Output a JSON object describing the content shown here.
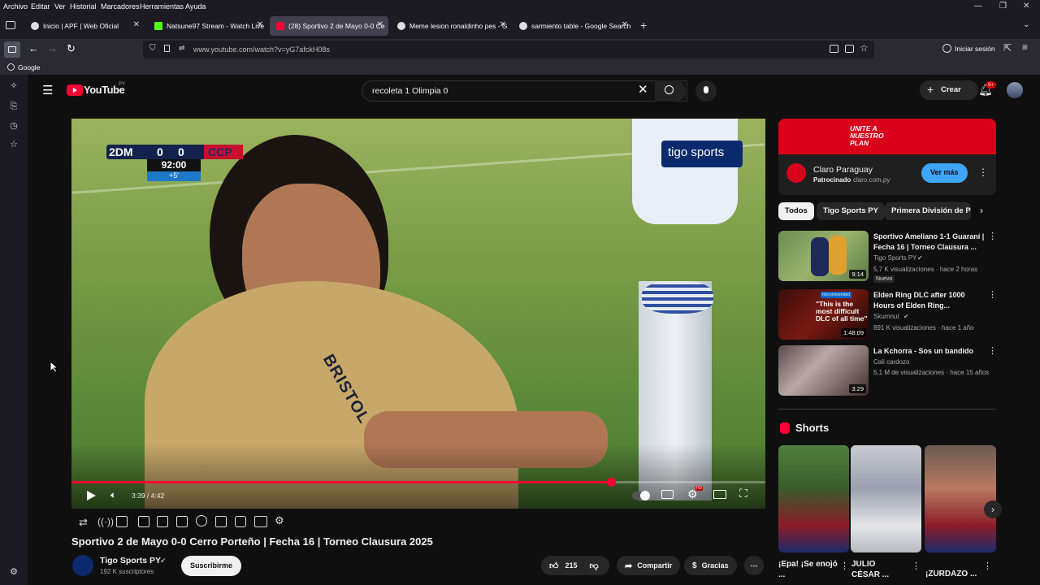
{
  "menubar": {
    "items": [
      "Archivo",
      "Editar",
      "Ver",
      "Historial",
      "Marcadores",
      "Herramientas",
      "Ayuda"
    ]
  },
  "tabs": [
    {
      "title": "Inicio | APF | Web Oficial",
      "color": "#dddddd"
    },
    {
      "title": "Natsune97 Stream - Watch Live",
      "color": "#53fc18"
    },
    {
      "title": "(28) Sportivo 2 de Mayo 0-0 Ce",
      "color": "#ff0033"
    },
    {
      "title": "Meme lesion ronaldinho pes - G",
      "color": "#dddddd"
    },
    {
      "title": "sarmiento table - Google Search",
      "color": "#dddddd"
    }
  ],
  "browser": {
    "url": "www.youtube.com/watch?v=yG7afckH08s",
    "signin": "Iniciar sesión",
    "bookmark": "Google"
  },
  "yt": {
    "logo": "YouTube",
    "region": "PY",
    "search_value": "recoleta 1 Olimpia 0",
    "create": "Crear",
    "notif_badge": "9+"
  },
  "player": {
    "score": {
      "home": "2DM",
      "home_goals": "0",
      "away_goals": "0",
      "away": "CCP",
      "clock": "92:00",
      "added": "+5'"
    },
    "broadcaster": "tigo sports",
    "time": "3:39 / 4:42",
    "progress": 0.777,
    "hd": "HD"
  },
  "video": {
    "title": "Sportivo 2 de Mayo 0-0 Cerro Porteño | Fecha 16 | Torneo Clausura 2025",
    "channel": "Tigo Sports PY",
    "subs": "192 K suscriptores",
    "subscribe": "Suscribirme",
    "likes": "215",
    "share": "Compartir",
    "thanks": "Gracias"
  },
  "ad": {
    "banner": "UNITE A NUESTRO PLAN",
    "name": "Claro Paraguay",
    "sponsored": "Patrocinado",
    "domain": "claro.com.py",
    "cta": "Ver más"
  },
  "chips": [
    "Todos",
    "Tigo Sports PY",
    "Primera División de Pa"
  ],
  "related": [
    {
      "title": "Sportivo Ameliano 1-1 Guaraní | Fecha 16 | Torneo Clausura ...",
      "channel": "Tigo Sports PY",
      "meta": "5,7 K visualizaciones · hace 2 horas",
      "badge": "Nuevo",
      "duration": "9:14"
    },
    {
      "title": "Elden Ring DLC after 1000 Hours of Elden Ring...",
      "channel": "Skumnut",
      "meta": "891 K visualizaciones · hace 1 año",
      "badge": "",
      "duration": "1:48:09",
      "thumb_text": "\"This is the most difficult DLC of all time\"",
      "thumb_tag": "Recommended"
    },
    {
      "title": "La Kchorra - Sos un bandido",
      "channel": "Cali cardozo",
      "meta": "5,1 M de visualizaciones · hace 15 años",
      "badge": "",
      "duration": "3:29"
    }
  ],
  "shorts": {
    "heading": "Shorts",
    "items": [
      {
        "title": "¡Epa! ¡Se enojó ..."
      },
      {
        "title": "JULIO CÉSAR ..."
      },
      {
        "title": "¡ZURDAZO ..."
      }
    ]
  }
}
